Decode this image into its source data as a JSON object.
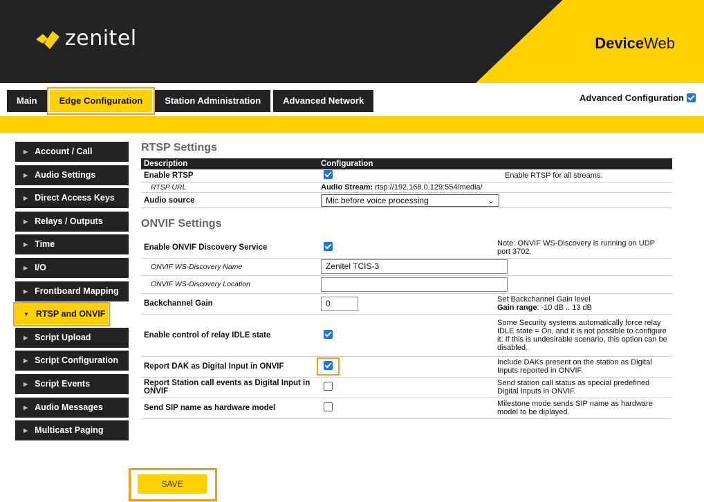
{
  "header": {
    "logo_text": "zenitel",
    "brand_bold": "Device",
    "brand_light": "Web"
  },
  "tabs": [
    {
      "label": "Main",
      "active": false
    },
    {
      "label": "Edge Configuration",
      "active": true
    },
    {
      "label": "Station Administration",
      "active": false
    },
    {
      "label": "Advanced Network",
      "active": false
    }
  ],
  "advanced_config": {
    "label": "Advanced Configuration",
    "checked": true
  },
  "sidebar": {
    "items": [
      {
        "label": "Account / Call"
      },
      {
        "label": "Audio Settings"
      },
      {
        "label": "Direct Access Keys"
      },
      {
        "label": "Relays / Outputs"
      },
      {
        "label": "Time"
      },
      {
        "label": "I/O"
      },
      {
        "label": "Frontboard Mapping"
      },
      {
        "label": "RTSP and ONVIF",
        "active": true
      },
      {
        "label": "Script Upload"
      },
      {
        "label": "Script Configuration"
      },
      {
        "label": "Script Events"
      },
      {
        "label": "Audio Messages"
      },
      {
        "label": "Multicast Paging"
      }
    ]
  },
  "rtsp": {
    "title": "RTSP Settings",
    "col_description": "Description",
    "col_configuration": "Configuration",
    "enable_label": "Enable RTSP",
    "enable_checked": true,
    "enable_note": "Enable RTSP for all streams.",
    "url_label": "RTSP URL",
    "url_prefix": "Audio Stream:",
    "url_value": "rtsp://192.168.0.129:554/media/",
    "audio_source_label": "Audio source",
    "audio_source_value": "Mic before voice processing"
  },
  "onvif": {
    "title": "ONVIF Settings",
    "discovery_label": "Enable ONVIF Discovery Service",
    "discovery_checked": true,
    "discovery_note": "Note: ONVIF WS-Discovery is running on UDP port 3702.",
    "name_label": "ONVIF WS-Discovery Name",
    "name_value": "Zenitel TCIS-3",
    "location_label": "ONVIF WS-Discovery Location",
    "location_value": "",
    "gain_label": "Backchannel Gain",
    "gain_value": "0",
    "gain_note": "Set Backchannel Gain level",
    "gain_range_label": "Gain range",
    "gain_range_value": ": -10 dB .. 13 dB",
    "relay_label": "Enable control of relay IDLE state",
    "relay_checked": true,
    "relay_note": "Some Security systems automatically force relay IDLE state = On, and it is not possible to configure it. If this is undesirable scenario, this option can be disabled.",
    "dak_label": "Report DAK as Digital Input in ONVIF",
    "dak_checked": true,
    "dak_note": "Include DAKs present on the station as Digital Inputs reported in ONVIF.",
    "call_label": "Report Station call events as Digital Input in ONVIF",
    "call_checked": false,
    "call_note": "Send station call status as special predefined Digital Inputs in ONVIF.",
    "sip_label": "Send SIP name as hardware model",
    "sip_checked": false,
    "sip_note": "Milestone mode sends SIP name as hardware model to be diplayed."
  },
  "save_label": "SAVE",
  "colors": {
    "accent": "#FFD100",
    "dark": "#232323",
    "highlight": "#F39C12",
    "checkbox": "#1A73E8"
  }
}
